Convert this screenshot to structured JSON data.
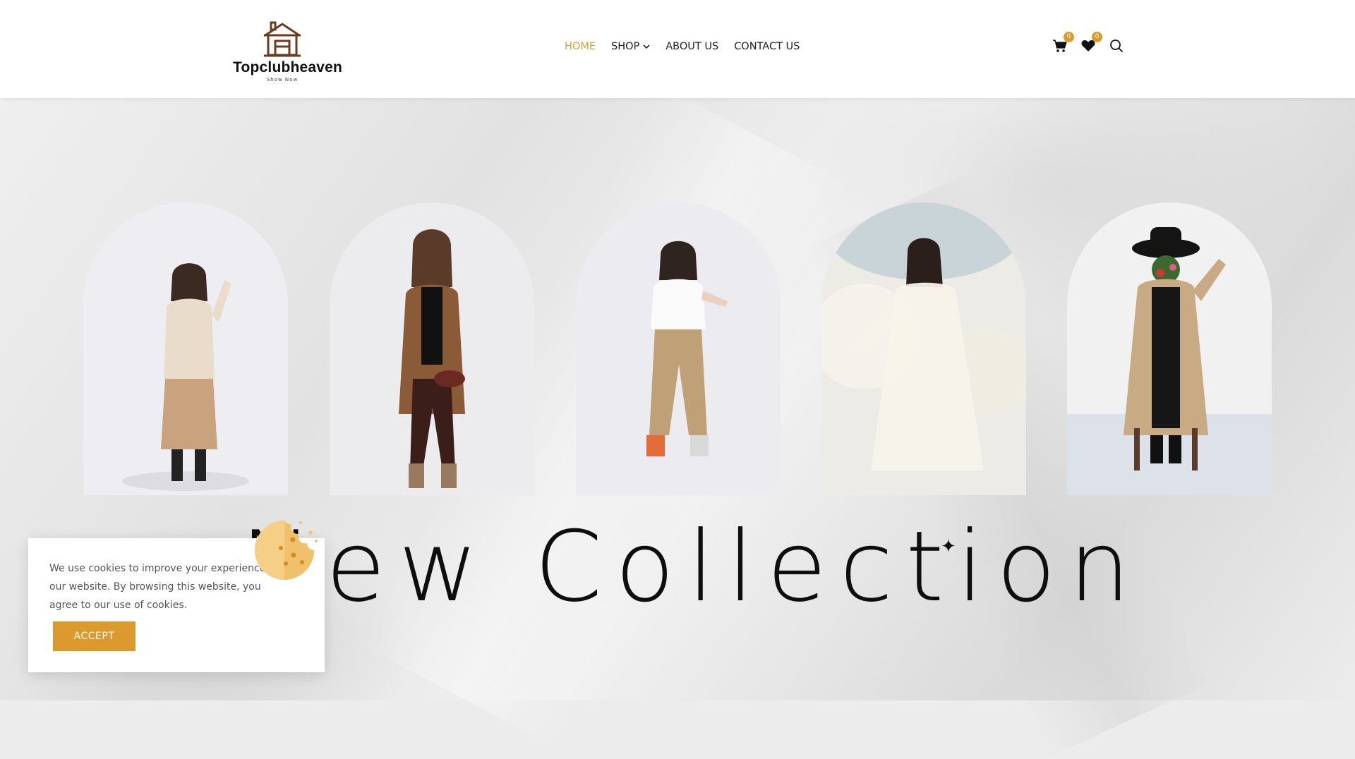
{
  "header": {
    "brand": "Topclubheaven",
    "tagline": "Show Now",
    "nav": [
      {
        "label": "HOME",
        "active": true
      },
      {
        "label": "SHOP",
        "has_dropdown": true
      },
      {
        "label": "ABOUT US"
      },
      {
        "label": "CONTACT US"
      }
    ],
    "cart_count": "0",
    "wishlist_count": "0",
    "accent_color": "#d4a23a"
  },
  "hero": {
    "headline": "New Collection",
    "models": [
      {
        "outfit": "beige knit sweater and ribbed skirt"
      },
      {
        "outfit": "brown shirt, black top and leather pants"
      },
      {
        "outfit": "white crop tee and khaki cargo pants"
      },
      {
        "outfit": "white flowing dress"
      },
      {
        "outfit": "beige trench coat with black hat"
      }
    ]
  },
  "cookie_notice": {
    "message": "We use cookies to improve your experience on our website. By browsing this website, you agree to our use of cookies.",
    "accept_label": "ACCEPT",
    "button_color": "#dc9a2e"
  }
}
